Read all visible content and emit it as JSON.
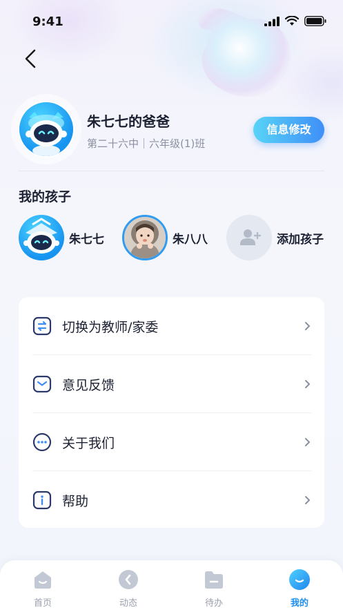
{
  "status_bar": {
    "time": "9:41"
  },
  "profile": {
    "name": "朱七七的爸爸",
    "school": "第二十六中｜六年级(1)班",
    "edit_label": "信息修改"
  },
  "children_section": {
    "title": "我的孩子",
    "children": [
      {
        "name": "朱七七"
      },
      {
        "name": "朱八八"
      }
    ],
    "add_label": "添加孩子"
  },
  "menu": [
    {
      "label": "切换为教师/家委",
      "icon": "swap-icon"
    },
    {
      "label": "意见反馈",
      "icon": "mail-icon"
    },
    {
      "label": "关于我们",
      "icon": "more-dots-icon"
    },
    {
      "label": "帮助",
      "icon": "info-icon"
    }
  ],
  "tabbar": {
    "tabs": [
      {
        "label": "首页",
        "icon": "home-icon"
      },
      {
        "label": "动态",
        "icon": "activity-icon"
      },
      {
        "label": "待办",
        "icon": "todo-folder-icon"
      },
      {
        "label": "我的",
        "icon": "profile-smile-icon"
      }
    ],
    "active_index": 3
  },
  "colors": {
    "accent": "#1f8ff0",
    "button_gradient_start": "#58d3f7",
    "button_gradient_end": "#3f8ff7",
    "text_primary": "#1d2233",
    "text_secondary": "#8b90a0",
    "icon_stroke": "#2b3a6b"
  }
}
